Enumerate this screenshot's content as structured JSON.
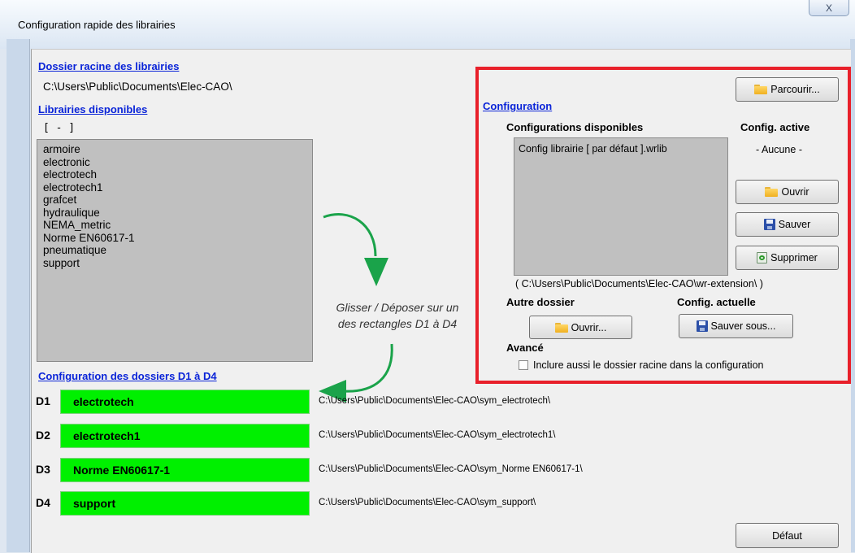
{
  "window": {
    "title": "Configuration rapide des librairies",
    "close_label": "X"
  },
  "root": {
    "heading": "Dossier racine des librairies",
    "path": "C:\\Users\\Public\\Documents\\Elec-CAO\\"
  },
  "libraries": {
    "heading": "Librairies disponibles",
    "collapse_label": "[ - ]",
    "items": [
      "armoire",
      "electronic",
      "electrotech",
      "electrotech1",
      "grafcet",
      "hydraulique",
      "NEMA_metric",
      "Norme EN60617-1",
      "pneumatique",
      "support"
    ]
  },
  "drag_hint": {
    "line1": "Glisser / Déposer sur un",
    "line2": "des rectangles D1 à D4"
  },
  "folders": {
    "heading": "Configuration des dossiers D1 à D4",
    "slots": [
      {
        "id": "D1",
        "name": "electrotech",
        "path": "C:\\Users\\Public\\Documents\\Elec-CAO\\sym_electrotech\\"
      },
      {
        "id": "D2",
        "name": "electrotech1",
        "path": "C:\\Users\\Public\\Documents\\Elec-CAO\\sym_electrotech1\\"
      },
      {
        "id": "D3",
        "name": "Norme EN60617-1",
        "path": "C:\\Users\\Public\\Documents\\Elec-CAO\\sym_Norme EN60617-1\\"
      },
      {
        "id": "D4",
        "name": "support",
        "path": "C:\\Users\\Public\\Documents\\Elec-CAO\\sym_support\\"
      }
    ]
  },
  "configuration": {
    "heading": "Configuration",
    "browse_label": "Parcourir...",
    "available_heading": "Configurations disponibles",
    "available_items": [
      "Config librairie [ par défaut ].wrlib"
    ],
    "active_heading": "Config. active",
    "active_value": "- Aucune -",
    "open_label": "Ouvrir",
    "save_label": "Sauver",
    "delete_label": "Supprimer",
    "ext_path": "( C:\\Users\\Public\\Documents\\Elec-CAO\\wr-extension\\ )",
    "other_folder_heading": "Autre dossier",
    "other_open_label": "Ouvrir...",
    "current_config_heading": "Config. actuelle",
    "save_as_label": "Sauver sous...",
    "advanced_heading": "Avancé",
    "include_root_label": "Inclure aussi le dossier racine dans la configuration",
    "include_root_checked": false
  },
  "footer": {
    "default_label": "Défaut"
  },
  "colors": {
    "slot_fill": "#00f000",
    "highlight_border": "#e8202a",
    "link": "#0a24d8",
    "arrow": "#1aa34a"
  }
}
